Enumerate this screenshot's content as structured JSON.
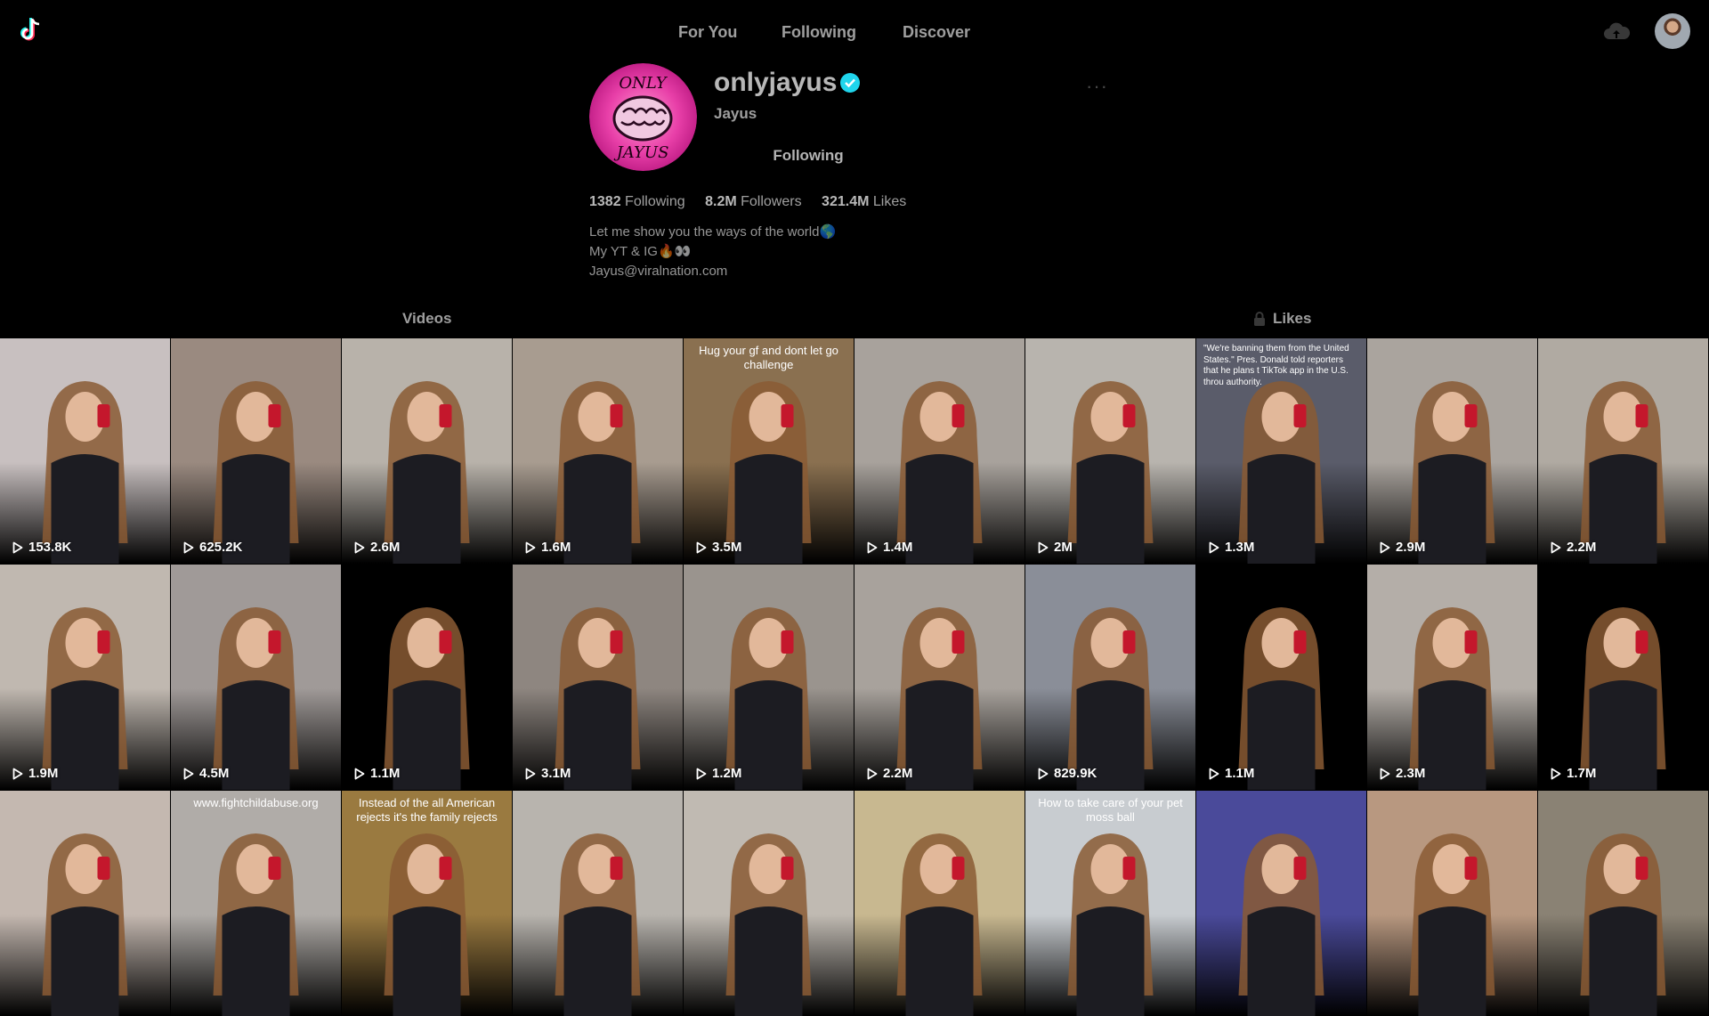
{
  "nav": {
    "items": [
      "For You",
      "Following",
      "Discover"
    ]
  },
  "profile": {
    "username": "onlyjayus",
    "display_name": "Jayus",
    "follow_label": "Following",
    "more_label": "···",
    "stats": [
      {
        "value": "1382",
        "label": "Following"
      },
      {
        "value": "8.2M",
        "label": "Followers"
      },
      {
        "value": "321.4M",
        "label": "Likes"
      }
    ],
    "bio": [
      "Let me show you the ways of the world🌎",
      "My YT & IG🔥👀",
      "Jayus@viralnation.com"
    ],
    "avatar_text_top": "ONLY",
    "avatar_text_bottom": "JAYUS"
  },
  "tabs": {
    "videos": "Videos",
    "likes": "Likes"
  },
  "videos": [
    {
      "views": "153.8K",
      "bg": "#c8c0c0"
    },
    {
      "views": "625.2K",
      "bg": "#9a8a80"
    },
    {
      "views": "2.6M",
      "bg": "#b8b2aa"
    },
    {
      "views": "1.6M",
      "bg": "#a89c90"
    },
    {
      "views": "3.5M",
      "bg": "#8a7050",
      "caption": "Hug your gf and dont let go challenge"
    },
    {
      "views": "1.4M",
      "bg": "#a8a29c"
    },
    {
      "views": "2M",
      "bg": "#b8b4ae"
    },
    {
      "views": "1.3M",
      "bg": "#5a5c6a",
      "caption": "\"We're banning them from the United States.\" Pres. Donald told reporters that he plans t TikTok app in the U.S. throu authority."
    },
    {
      "views": "2.9M",
      "bg": "#aaa49e"
    },
    {
      "views": "2.2M",
      "bg": "#b0aaa2"
    },
    {
      "views": "1.9M",
      "bg": "#c0b8b0"
    },
    {
      "views": "4.5M",
      "bg": "#a09a98"
    },
    {
      "views": "1.1M",
      "bg": "#000000"
    },
    {
      "views": "3.1M",
      "bg": "#8e8680"
    },
    {
      "views": "1.2M",
      "bg": "#9a948e"
    },
    {
      "views": "2.2M",
      "bg": "#a8a29c"
    },
    {
      "views": "829.9K",
      "bg": "#8a8e98"
    },
    {
      "views": "1.1M",
      "bg": "#000000"
    },
    {
      "views": "2.3M",
      "bg": "#b4aea8"
    },
    {
      "views": "1.7M",
      "bg": "#000000"
    },
    {
      "views": "",
      "bg": "#c4b8b0"
    },
    {
      "views": "",
      "bg": "#b0aca8",
      "caption": "www.fightchildabuse.org"
    },
    {
      "views": "",
      "bg": "#9a7a40",
      "caption": "Instead of the all American rejects it's the family rejects"
    },
    {
      "views": "",
      "bg": "#b8b4ae"
    },
    {
      "views": "",
      "bg": "#c0bab2"
    },
    {
      "views": "",
      "bg": "#c8b890"
    },
    {
      "views": "",
      "bg": "#c8ccd0",
      "caption": "How to take care of your pet moss ball"
    },
    {
      "views": "",
      "bg": "#4a4a9a"
    },
    {
      "views": "",
      "bg": "#b89880"
    },
    {
      "views": "",
      "bg": "#8a8274"
    }
  ],
  "colors": {
    "background": "#000000",
    "verified": "#20d5ec",
    "text_dim": "rgba(255,255,255,0.62)"
  }
}
